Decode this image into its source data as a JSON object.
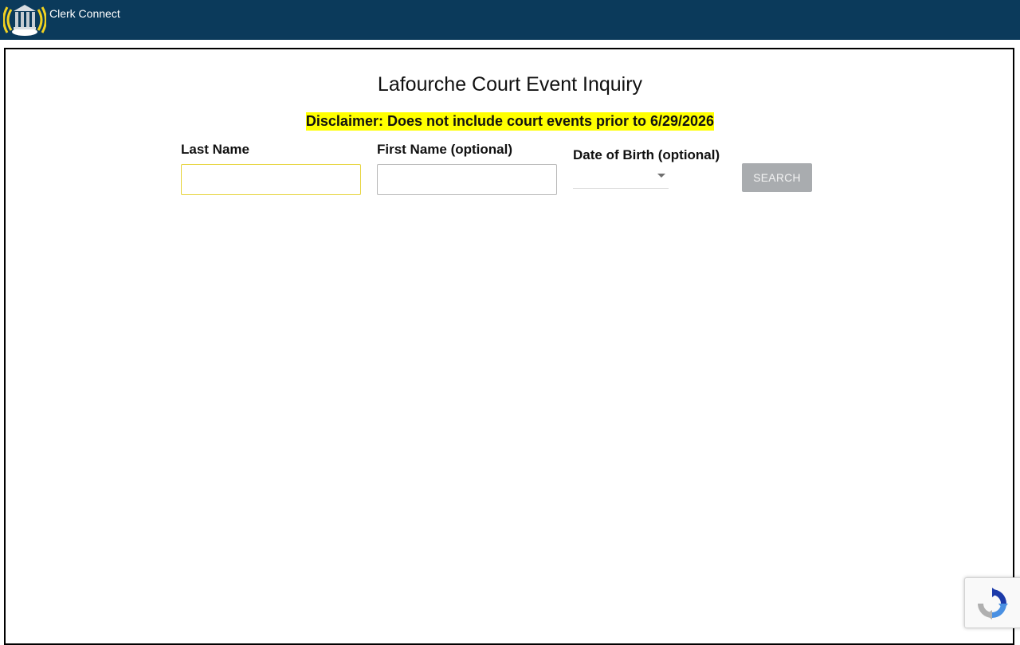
{
  "header": {
    "app_title": "Clerk Connect",
    "logo_icon": "courthouse-signal-icon",
    "background_color": "#0b3a5b"
  },
  "main": {
    "title": "Lafourche Court Event Inquiry",
    "disclaimer": "Disclaimer: Does not include court events prior to 6/29/2026",
    "disclaimer_highlight_color": "#ffff00"
  },
  "form": {
    "last_name": {
      "label": "Last Name",
      "value": "",
      "placeholder": ""
    },
    "first_name": {
      "label": "First Name (optional)",
      "value": "",
      "placeholder": ""
    },
    "date_of_birth": {
      "label": "Date of Birth (optional)",
      "value": ""
    },
    "search_button": {
      "label": "SEARCH"
    }
  },
  "recaptcha": {
    "icon": "recaptcha-icon"
  }
}
